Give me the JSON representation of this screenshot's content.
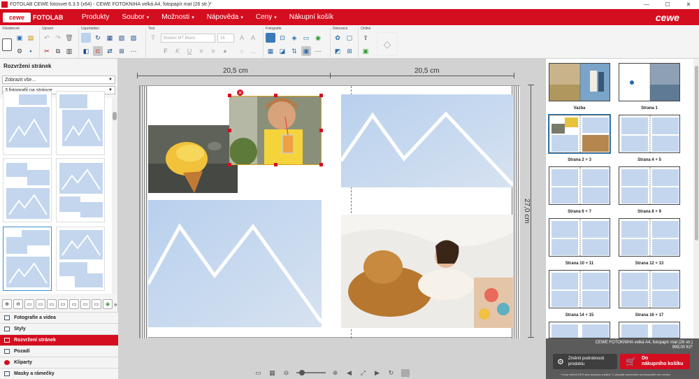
{
  "window": {
    "title": "FOTOLAB CEWE fotosvet 6.3.5 (x64) - CEWE FOTOKNIHA velká A4, fotopapír mat (26 str.)*",
    "minimize": "—",
    "maximize": "☐",
    "close": "✕"
  },
  "menubar": {
    "logo": "cewe",
    "logo_suffix": "FOTOLAB",
    "items": [
      {
        "label": "Produkty",
        "caret": ""
      },
      {
        "label": "Soubor",
        "caret": "▾"
      },
      {
        "label": "Možnosti",
        "caret": "▾"
      },
      {
        "label": "Nápověda",
        "caret": "▾"
      },
      {
        "label": "Ceny",
        "caret": "▾"
      },
      {
        "label": "Nákupní košík",
        "caret": ""
      }
    ],
    "brand": "cewe"
  },
  "toolbar": {
    "groups": [
      "Všeobecné",
      "Upravit",
      "Uspořádání",
      "Text",
      "Fotografie",
      "Dekorace",
      "Online"
    ],
    "font": "Bodoni MT Black",
    "font_size": "16"
  },
  "left_panel": {
    "title": "Rozvržení stránek",
    "filter": "Zobrazit vše...",
    "photo_count": "3 fotografií na stránce",
    "sections": [
      {
        "label": "Fotografie a videa",
        "active": false
      },
      {
        "label": "Styly",
        "active": false
      },
      {
        "label": "Rozvržení stránek",
        "active": true
      },
      {
        "label": "Pozadí",
        "active": false
      },
      {
        "label": "Kliparty",
        "active": false
      },
      {
        "label": "Masky a rámečky",
        "active": false
      }
    ]
  },
  "canvas": {
    "width_left": "20,5 cm",
    "width_right": "20,5 cm",
    "height": "27,0 cm"
  },
  "right_panel": {
    "pages": [
      {
        "label": "Vazba"
      },
      {
        "label": "Strana 1"
      },
      {
        "label": "Strana 2 + 3",
        "selected": true
      },
      {
        "label": "Strana 4 + 5"
      },
      {
        "label": "Strana 6 + 7"
      },
      {
        "label": "Strana 8 + 9"
      },
      {
        "label": "Strana 10 + 11"
      },
      {
        "label": "Strana 12 + 13"
      },
      {
        "label": "Strana 14 + 15"
      },
      {
        "label": "Strana 16 + 17"
      }
    ],
    "product": "CEWE FOTOKNIHA velká A4, fotopapír mat (26 str.)",
    "price": "999,00 Kč*",
    "details_button": "Změnit podrobnosti produktu",
    "cart_button_1": "Do",
    "cart_button_2": "nákupního košíku",
    "footnote": "* Ceny včetně DPH plus doprava a balné. V případě vyzvednutí na fotoslužbě bez ceníku."
  },
  "colors": {
    "brand_red": "#d40d1f",
    "placeholder_blue": "#c3d6ee",
    "selection_blue": "#2f8bd3"
  }
}
